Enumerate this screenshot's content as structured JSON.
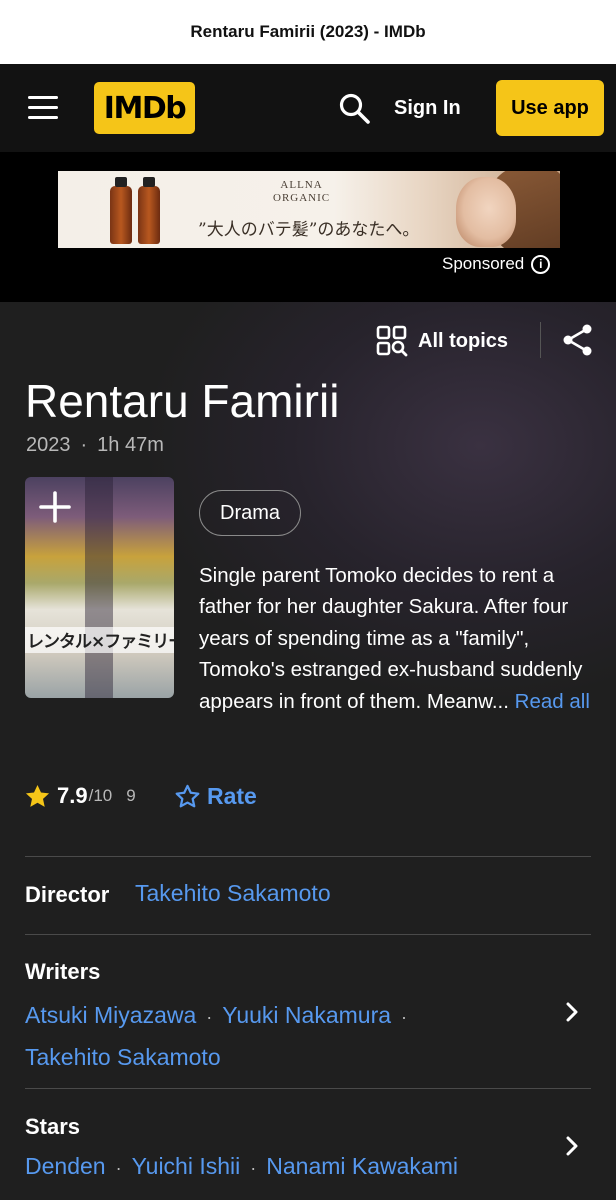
{
  "browser": {
    "tab_title": "Rentaru Famirii (2023) - IMDb"
  },
  "header": {
    "logo": "IMDb",
    "sign_in": "Sign In",
    "use_app": "Use app"
  },
  "ad": {
    "brand_line1": "ALLNA",
    "brand_line2": "ORGANIC",
    "copy": "”大人のバテ髪”のあなたへ。",
    "sponsored_label": "Sponsored"
  },
  "toolbar": {
    "all_topics": "All topics"
  },
  "title": {
    "name": "Rentaru Famirii",
    "year": "2023",
    "dot": "·",
    "runtime": "1h 47m"
  },
  "poster": {
    "title_text": "レンタル×ファミリー"
  },
  "genres": [
    "Drama"
  ],
  "plot": {
    "text": "Single parent Tomoko decides to rent a father for her daughter Sakura. After four years of spending time as a \"family\", Tomoko's estranged ex-husband suddenly appears in front of them. Meanw...",
    "read_all": "Read all"
  },
  "rating": {
    "score": "7.9",
    "out_of": "/10",
    "count": "9",
    "rate_label": "Rate"
  },
  "credits": {
    "director": {
      "label": "Director",
      "names": [
        "Takehito Sakamoto"
      ]
    },
    "writers": {
      "label": "Writers",
      "names": [
        "Atsuki Miyazawa",
        "Yuuki Nakamura",
        "Takehito Sakamoto"
      ]
    },
    "stars": {
      "label": "Stars",
      "names": [
        "Denden",
        "Yuichi Ishii",
        "Nanami Kawakami"
      ]
    },
    "separator": "·"
  },
  "colors": {
    "imdb_yellow": "#f5c518",
    "link_blue": "#5799ef",
    "background": "#1f1f1f"
  }
}
